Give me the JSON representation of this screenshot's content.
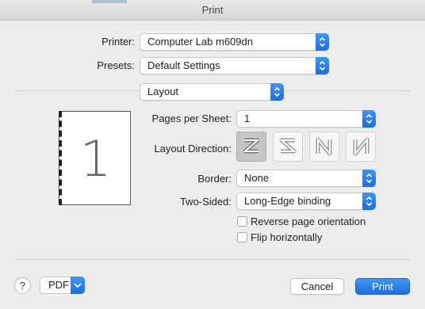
{
  "window": {
    "title": "Print"
  },
  "printer": {
    "label": "Printer:",
    "value": "Computer Lab m609dn"
  },
  "presets": {
    "label": "Presets:",
    "value": "Default Settings"
  },
  "section": {
    "value": "Layout"
  },
  "preview": {
    "page_number": "1"
  },
  "layout": {
    "pages_per_sheet": {
      "label": "Pages per Sheet:",
      "value": "1"
    },
    "direction": {
      "label": "Layout Direction:",
      "options": [
        "z-right-icon",
        "z-left-icon",
        "n-down-icon",
        "n-reverse-icon"
      ],
      "selected_index": 0
    },
    "border": {
      "label": "Border:",
      "value": "None"
    },
    "two_sided": {
      "label": "Two-Sided:",
      "value": "Long-Edge binding"
    },
    "reverse_orientation": {
      "label": "Reverse page orientation",
      "checked": false
    },
    "flip_horizontally": {
      "label": "Flip horizontally",
      "checked": false
    }
  },
  "footer": {
    "help_label": "?",
    "pdf_label": "PDF",
    "cancel_label": "Cancel",
    "print_label": "Print"
  },
  "colors": {
    "accent": "#1e6fdd",
    "window_bg": "#ececec"
  }
}
